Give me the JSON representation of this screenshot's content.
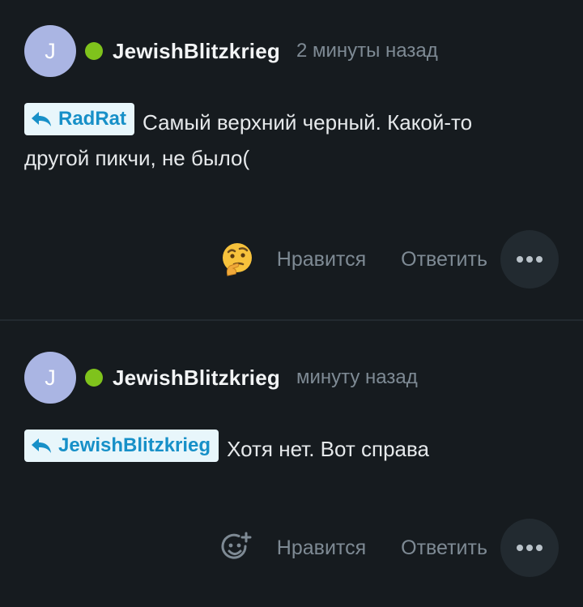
{
  "comments": [
    {
      "avatar_letter": "J",
      "username": "JewishBlitzkrieg",
      "timestamp": "2 минуты назад",
      "reply_to": "RadRat",
      "text": "Самый верхний черный. Какой-то другой пикчи, не было(",
      "reaction_icon": "thinking-face-emoji",
      "like_label": "Нравится",
      "reply_label": "Ответить"
    },
    {
      "avatar_letter": "J",
      "username": "JewishBlitzkrieg",
      "timestamp": "минуту назад",
      "reply_to": "JewishBlitzkrieg",
      "text": "Хотя нет. Вот справа",
      "reaction_icon": "add-reaction-icon",
      "like_label": "Нравится",
      "reply_label": "Ответить"
    }
  ],
  "colors": {
    "background": "#161b1f",
    "avatar": "#aab5e3",
    "online": "#7fc31c",
    "reply_tag_bg": "#e8f6fb",
    "reply_tag_text": "#1790c8",
    "muted_text": "#7e8a94"
  }
}
